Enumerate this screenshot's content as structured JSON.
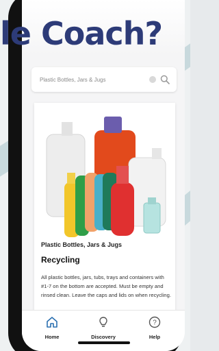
{
  "headline": "le Coach?",
  "search": {
    "placeholder": "Plastic Bottles, Jars & Jugs"
  },
  "item": {
    "category": "Plastic Bottles, Jars & Jugs",
    "title": "Recycling",
    "description": "All plastic bottles, jars, tubs, trays and containers with #1-7 on the bottom are accepted. Must be empty and rinsed clean. Leave the caps and lids on when recycling."
  },
  "tabs": [
    {
      "label": "Home",
      "icon": "home-icon"
    },
    {
      "label": "Discovery",
      "icon": "lightbulb-icon"
    },
    {
      "label": "Help",
      "icon": "question-icon"
    }
  ],
  "colors": {
    "headline": "#2d3b78",
    "accent": "#2a6fb0",
    "background_stripe": "#c3d6da"
  }
}
